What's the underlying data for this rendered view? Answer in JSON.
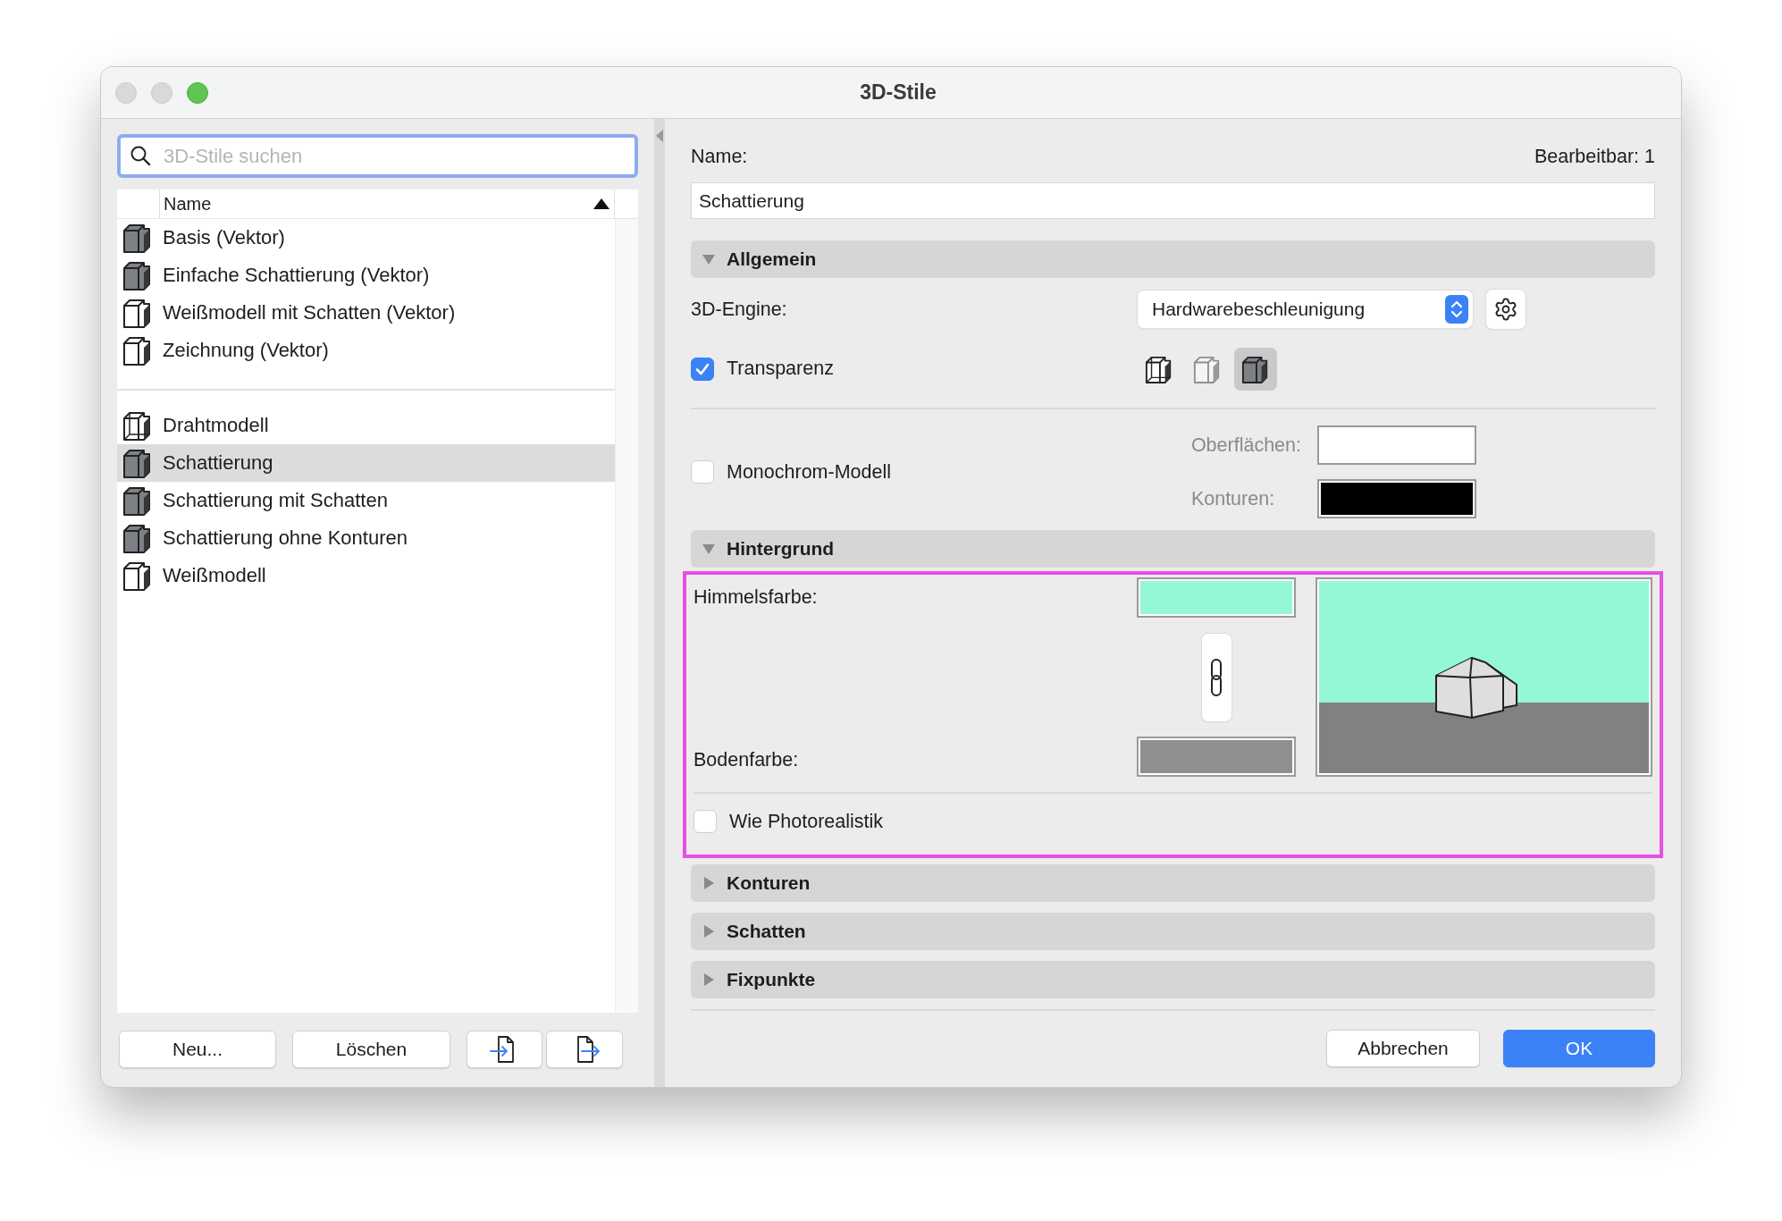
{
  "window": {
    "title": "3D-Stile"
  },
  "search": {
    "placeholder": "3D-Stile suchen"
  },
  "list": {
    "column": "Name",
    "sorted_ascending": true,
    "groups": [
      [
        {
          "label": "Basis (Vektor)",
          "kind": "shaded",
          "selected": false
        },
        {
          "label": "Einfache Schattierung (Vektor)",
          "kind": "shaded",
          "selected": false
        },
        {
          "label": "Weißmodell mit Schatten (Vektor)",
          "kind": "white",
          "selected": false
        },
        {
          "label": "Zeichnung (Vektor)",
          "kind": "white",
          "selected": false
        }
      ],
      [
        {
          "label": "Drahtmodell",
          "kind": "wire",
          "selected": false
        },
        {
          "label": "Schattierung",
          "kind": "shaded",
          "selected": true
        },
        {
          "label": "Schattierung mit Schatten",
          "kind": "shaded",
          "selected": false
        },
        {
          "label": "Schattierung ohne Konturen",
          "kind": "shaded",
          "selected": false
        },
        {
          "label": "Weißmodell",
          "kind": "white",
          "selected": false
        }
      ]
    ]
  },
  "list_buttons": [
    {
      "kind": "text",
      "label": "Neu..."
    },
    {
      "kind": "text",
      "label": "Löschen"
    },
    {
      "kind": "import"
    },
    {
      "kind": "export"
    }
  ],
  "name": {
    "label": "Name:",
    "value": "Schattierung",
    "editable": "Bearbeitbar: 1"
  },
  "sections": [
    {
      "kind": "general",
      "title": "Allgemein",
      "expanded": true,
      "engine_label": "3D-Engine:",
      "engine": "Hardwarebeschleunigung",
      "transparency": {
        "label": "Transparenz",
        "checked": true
      },
      "modes": [
        {
          "kind": "wire",
          "selected": false,
          "disabled": false
        },
        {
          "kind": "white",
          "selected": false,
          "disabled": true
        },
        {
          "kind": "shaded",
          "selected": true,
          "disabled": false
        }
      ],
      "monochrome": {
        "label": "Monochrom-Modell",
        "checked": false
      },
      "surfaces": {
        "label": "Oberflächen:",
        "color": "#ffffff"
      },
      "contours": {
        "label": "Konturen:",
        "color": "#000000"
      }
    },
    {
      "kind": "background",
      "title": "Hintergrund",
      "expanded": true,
      "highlighted": true,
      "sky": {
        "label": "Himmelsfarbe:",
        "color": "#95f8d5"
      },
      "ground": {
        "label": "Bodenfarbe:",
        "color": "#8f8f8f"
      },
      "photorealistic": {
        "label": "Wie Photorealistik",
        "checked": false
      }
    },
    {
      "kind": "plain",
      "title": "Konturen",
      "expanded": false
    },
    {
      "kind": "plain",
      "title": "Schatten",
      "expanded": false
    },
    {
      "kind": "plain",
      "title": "Fixpunkte",
      "expanded": false
    }
  ],
  "footer": {
    "cancel": "Abbrechen",
    "ok": "OK"
  }
}
